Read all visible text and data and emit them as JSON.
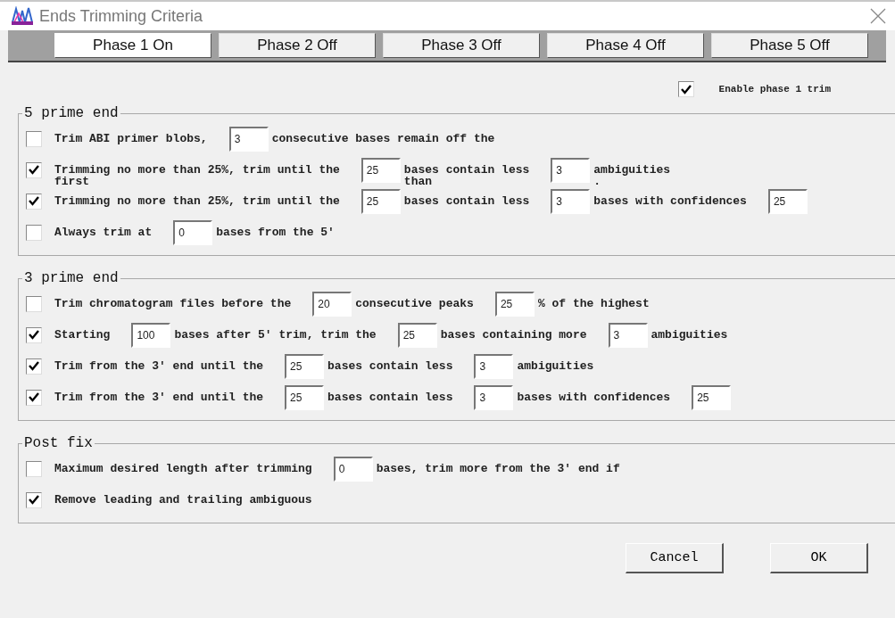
{
  "window": {
    "title": "Ends Trimming Criteria"
  },
  "phase_tabs": [
    {
      "label": "Phase 1 On",
      "selected": true
    },
    {
      "label": "Phase 2 Off",
      "selected": false
    },
    {
      "label": "Phase 3 Off",
      "selected": false
    },
    {
      "label": "Phase 4 Off",
      "selected": false
    },
    {
      "label": "Phase 5 Off",
      "selected": false
    }
  ],
  "enable": {
    "label": "Enable phase 1 trim",
    "checked": true
  },
  "groups": [
    {
      "title": "5 prime end",
      "rows": [
        {
          "checked": false,
          "parts": [
            {
              "kind": "text",
              "text": "Trim ABI primer blobs,"
            },
            {
              "kind": "field",
              "value": "3"
            },
            {
              "kind": "text",
              "text": "consecutive bases remain off the"
            }
          ]
        },
        {
          "checked": true,
          "parts": [
            {
              "kind": "text",
              "text": "Trimming no more than 25%, trim until the",
              "below": "first"
            },
            {
              "kind": "field",
              "value": "25"
            },
            {
              "kind": "text",
              "text": "bases contain less",
              "below": "than"
            },
            {
              "kind": "field",
              "value": "3"
            },
            {
              "kind": "text",
              "text": "ambiguities",
              "below": "."
            }
          ]
        },
        {
          "checked": true,
          "parts": [
            {
              "kind": "text",
              "text": "Trimming no more than 25%, trim until the"
            },
            {
              "kind": "field",
              "value": "25"
            },
            {
              "kind": "text",
              "text": "bases contain less"
            },
            {
              "kind": "field",
              "value": "3"
            },
            {
              "kind": "text",
              "text": "bases with confidences"
            },
            {
              "kind": "field",
              "value": "25"
            }
          ]
        },
        {
          "checked": false,
          "parts": [
            {
              "kind": "text",
              "text": "Always trim at"
            },
            {
              "kind": "field",
              "value": "0"
            },
            {
              "kind": "text",
              "text": "bases from the 5'"
            }
          ]
        }
      ]
    },
    {
      "title": "3 prime end",
      "rows": [
        {
          "checked": false,
          "parts": [
            {
              "kind": "text",
              "text": "Trim chromatogram files before the"
            },
            {
              "kind": "field",
              "value": "20"
            },
            {
              "kind": "text",
              "text": "consecutive peaks"
            },
            {
              "kind": "field",
              "value": "25"
            },
            {
              "kind": "text",
              "text": "% of the highest"
            }
          ]
        },
        {
          "checked": true,
          "parts": [
            {
              "kind": "text",
              "text": "Starting"
            },
            {
              "kind": "field",
              "value": "100"
            },
            {
              "kind": "text",
              "text": "bases after 5' trim, trim the"
            },
            {
              "kind": "field",
              "value": "25"
            },
            {
              "kind": "text",
              "text": "bases containing more"
            },
            {
              "kind": "field",
              "value": "3"
            },
            {
              "kind": "text",
              "text": "ambiguities"
            }
          ]
        },
        {
          "checked": true,
          "parts": [
            {
              "kind": "text",
              "text": "Trim from the 3' end until the"
            },
            {
              "kind": "field",
              "value": "25"
            },
            {
              "kind": "text",
              "text": "bases contain less"
            },
            {
              "kind": "field",
              "value": "3"
            },
            {
              "kind": "text",
              "text": "ambiguities"
            }
          ]
        },
        {
          "checked": true,
          "parts": [
            {
              "kind": "text",
              "text": "Trim from the 3' end until the"
            },
            {
              "kind": "field",
              "value": "25"
            },
            {
              "kind": "text",
              "text": "bases contain less"
            },
            {
              "kind": "field",
              "value": "3"
            },
            {
              "kind": "text",
              "text": "bases with confidences"
            },
            {
              "kind": "field",
              "value": "25"
            }
          ]
        }
      ]
    },
    {
      "title": "Post fix",
      "rows": [
        {
          "checked": false,
          "parts": [
            {
              "kind": "text",
              "text": "Maximum desired length after trimming"
            },
            {
              "kind": "field",
              "value": "0"
            },
            {
              "kind": "text",
              "text": "bases, trim more from the 3' end if"
            }
          ]
        },
        {
          "checked": true,
          "parts": [
            {
              "kind": "text",
              "text": "Remove leading and trailing ambiguous"
            }
          ]
        }
      ]
    }
  ],
  "buttons": [
    {
      "label": "Cancel"
    },
    {
      "label": "OK"
    }
  ]
}
